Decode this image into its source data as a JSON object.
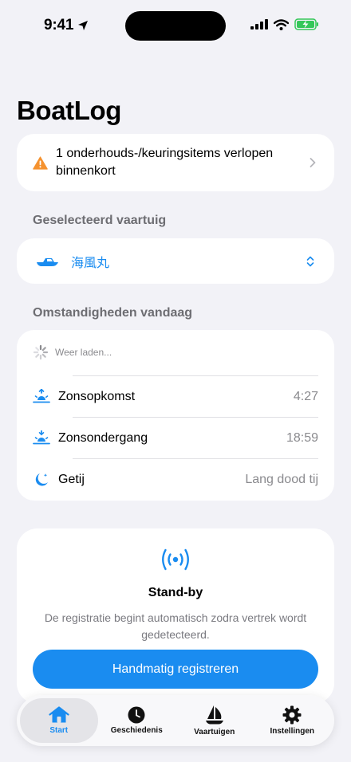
{
  "status_bar": {
    "time": "9:41"
  },
  "app": {
    "title": "BoatLog"
  },
  "alert": {
    "text": "1 onderhouds-/keuringsitems verlopen binnenkort"
  },
  "vessel_section": {
    "label": "Geselecteerd vaartuig",
    "selected_vessel": "海風丸"
  },
  "conditions": {
    "label": "Omstandigheden vandaag",
    "weather_status": "Weer laden...",
    "rows": [
      {
        "label": "Zonsopkomst",
        "value": "4:27",
        "icon": "sunrise-icon"
      },
      {
        "label": "Zonsondergang",
        "value": "18:59",
        "icon": "sunset-icon"
      },
      {
        "label": "Getij",
        "value": "Lang dood tij",
        "icon": "moon-icon"
      }
    ]
  },
  "standby": {
    "title": "Stand-by",
    "description": "De registratie begint automatisch zodra vertrek wordt gedetecteerd.",
    "button_label": "Handmatig registreren"
  },
  "tabs": [
    {
      "label": "Start",
      "icon": "house-icon",
      "active": true
    },
    {
      "label": "Geschiedenis",
      "icon": "clock-icon",
      "active": false
    },
    {
      "label": "Vaartuigen",
      "icon": "sailboat-icon",
      "active": false
    },
    {
      "label": "Instellingen",
      "icon": "gear-icon",
      "active": false
    }
  ],
  "colors": {
    "accent": "#1a8cf0",
    "warning": "#f5922f",
    "battery": "#34c759",
    "background": "#f2f2f7"
  }
}
